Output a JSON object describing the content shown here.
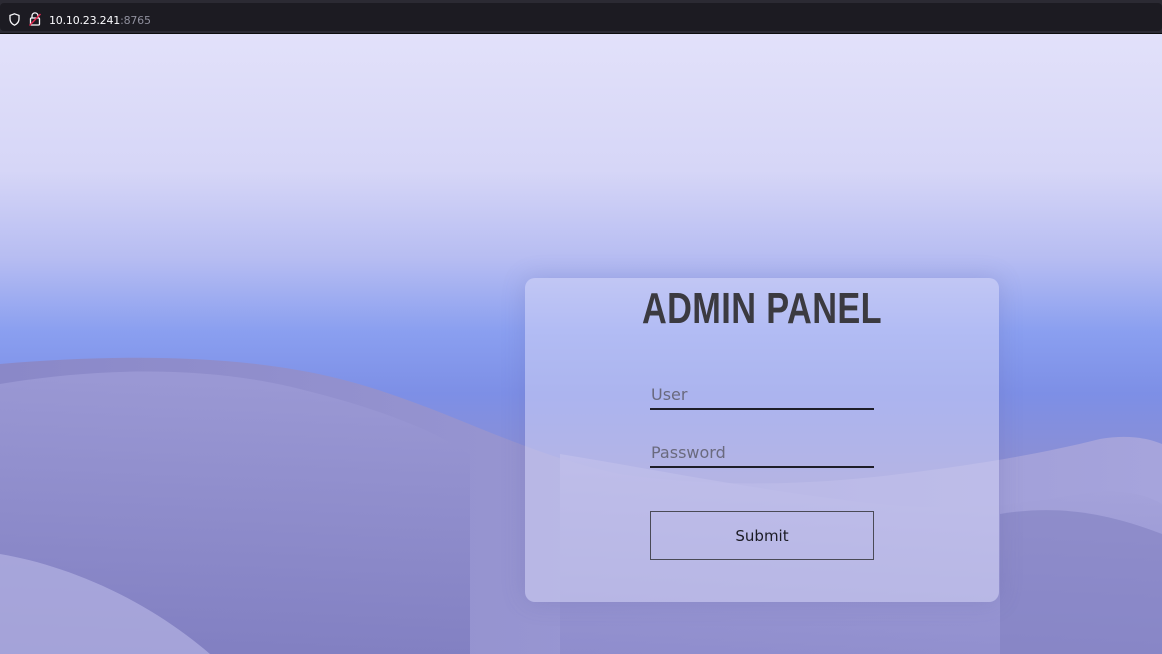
{
  "browser": {
    "url_host": "10.10.23.241",
    "url_port": ":8765",
    "icons": [
      "shield-icon",
      "lock-insecure-icon"
    ]
  },
  "login": {
    "title": "ADMIN PANEL",
    "user_placeholder": "User",
    "password_placeholder": "Password",
    "submit_label": "Submit"
  },
  "colors": {
    "sky_top": "#e2e1fa",
    "sky_horizon": "#7d8fe6",
    "dune": "#8a88c8",
    "title": "#3b3a40"
  }
}
